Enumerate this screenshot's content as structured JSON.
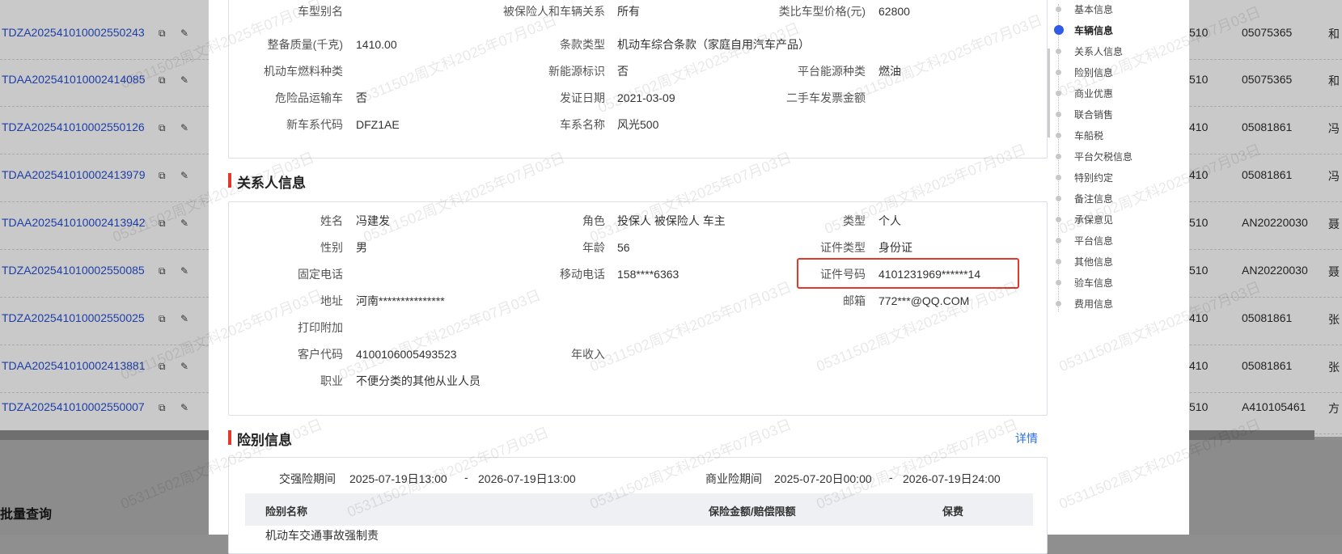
{
  "background": {
    "rows": [
      {
        "no": "TDZA202541010002550243",
        "c1": "510",
        "c2": "05075365",
        "c3": "和"
      },
      {
        "no": "TDAA202541010002414085",
        "c1": "510",
        "c2": "05075365",
        "c3": "和"
      },
      {
        "no": "TDZA202541010002550126",
        "c1": "410",
        "c2": "05081861",
        "c3": "冯"
      },
      {
        "no": "TDAA202541010002413979",
        "c1": "410",
        "c2": "05081861",
        "c3": "冯"
      },
      {
        "no": "TDAA202541010002413942",
        "c1": "510",
        "c2": "AN20220030",
        "c3": "聂"
      },
      {
        "no": "TDZA202541010002550085",
        "c1": "510",
        "c2": "AN20220030",
        "c3": "聂"
      },
      {
        "no": "TDZA202541010002550025",
        "c1": "410",
        "c2": "05081861",
        "c3": "张"
      },
      {
        "no": "TDAA202541010002413881",
        "c1": "410",
        "c2": "05081861",
        "c3": "张"
      },
      {
        "no": "TDZA202541010002550007",
        "c1": "510",
        "c2": "A410105461",
        "c3": "方"
      }
    ],
    "batch_query": "批量查询"
  },
  "vehicle": {
    "fields": [
      {
        "label": "车型别名",
        "value": ""
      },
      {
        "label": "被保险人和车辆关系",
        "value": "所有"
      },
      {
        "label": "类比车型价格(元)",
        "value": "62800"
      },
      {
        "label": "整备质量(千克)",
        "value": "1410.00"
      },
      {
        "label": "条款类型",
        "value": "机动车综合条款（家庭自用汽车产品）"
      },
      {
        "label": "机动车燃料种类",
        "value": ""
      },
      {
        "label": "新能源标识",
        "value": "否"
      },
      {
        "label": "平台能源种类",
        "value": "燃油"
      },
      {
        "label": "危险品运输车",
        "value": "否"
      },
      {
        "label": "发证日期",
        "value": "2021-03-09"
      },
      {
        "label": "二手车发票金额",
        "value": ""
      },
      {
        "label": "新车系代码",
        "value": "DFZ1AE"
      },
      {
        "label": "车系名称",
        "value": "风光500"
      }
    ]
  },
  "contact": {
    "title": "关系人信息",
    "fields": [
      {
        "label": "姓名",
        "value": "冯建发"
      },
      {
        "label": "角色",
        "value": "投保人 被保险人 车主"
      },
      {
        "label": "类型",
        "value": "个人"
      },
      {
        "label": "性别",
        "value": "男"
      },
      {
        "label": "年龄",
        "value": "56"
      },
      {
        "label": "证件类型",
        "value": "身份证"
      },
      {
        "label": "固定电话",
        "value": ""
      },
      {
        "label": "移动电话",
        "value": "158****6363"
      },
      {
        "label": "证件号码",
        "value": "4101231969******14"
      },
      {
        "label": "地址",
        "value": "河南***************"
      },
      {
        "label": "邮箱",
        "value": "772***@QQ.COM"
      },
      {
        "label": "打印附加",
        "value": ""
      },
      {
        "label": "客户代码",
        "value": "4100106005493523"
      },
      {
        "label": "年收入",
        "value": ""
      },
      {
        "label": "职业",
        "value": "不便分类的其他从业人员"
      }
    ]
  },
  "risk": {
    "title": "险别信息",
    "detail": "详情",
    "compulsory_label": "交强险期间",
    "compulsory_start": "2025-07-19日13:00",
    "compulsory_sep": "-",
    "compulsory_end": "2026-07-19日13:00",
    "commercial_label": "商业险期间",
    "commercial_start": "2025-07-20日00:00",
    "commercial_sep": "-",
    "commercial_end": "2026-07-19日24:00",
    "columns": [
      "险别名称",
      "保险金额/赔偿限额",
      "保费"
    ],
    "first_row": "机动车交通事故强制责"
  },
  "nav": {
    "items": [
      "基本信息",
      "车辆信息",
      "关系人信息",
      "险别信息",
      "商业优惠",
      "联合销售",
      "车船税",
      "平台欠税信息",
      "特别约定",
      "备注信息",
      "承保意见",
      "平台信息",
      "其他信息",
      "验车信息",
      "费用信息"
    ],
    "active_index": 1
  },
  "watermark": "05311502周文科2025年07月03日"
}
